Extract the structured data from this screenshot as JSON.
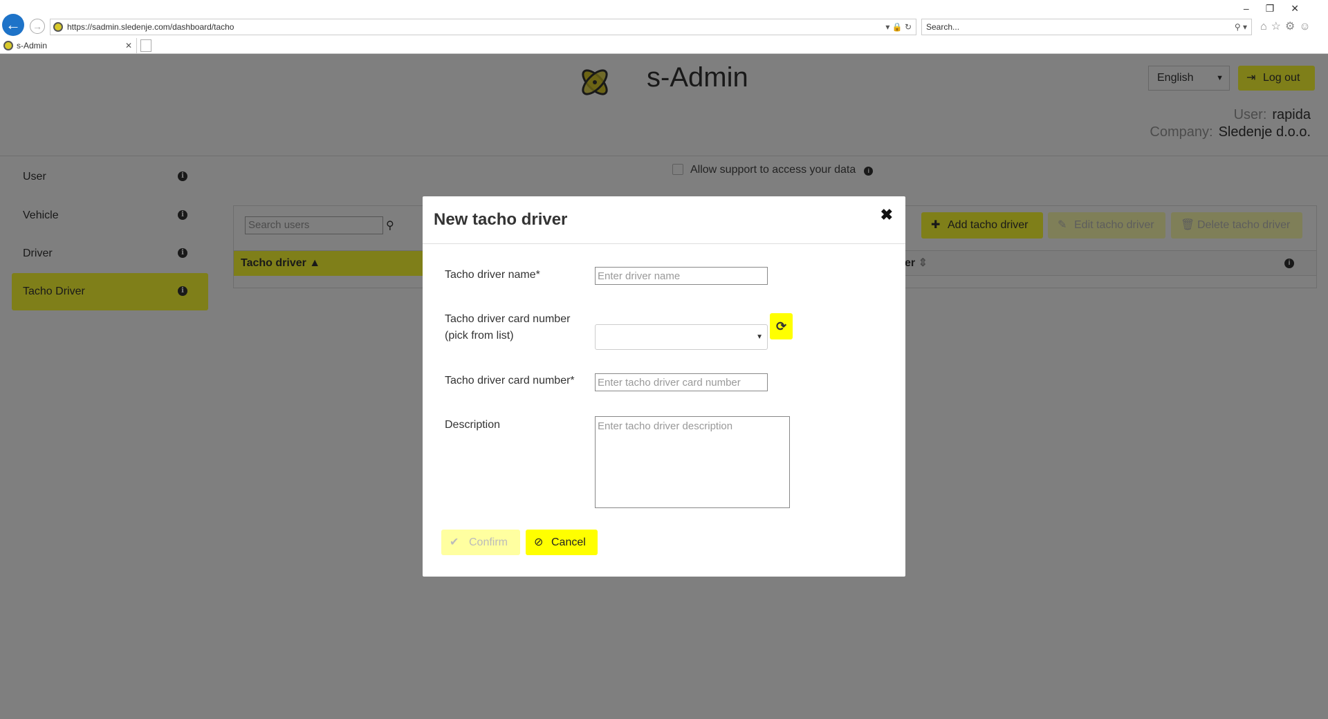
{
  "browser": {
    "url": "https://sadmin.sledenje.com/dashboard/tacho",
    "search_placeholder": "Search...",
    "tab_title": "s-Admin",
    "window_controls": "–❐✕"
  },
  "header": {
    "title": "s-Admin",
    "language": "English",
    "logout": "Log out",
    "user_label": "User:",
    "user": "rapida",
    "company_label": "Company:",
    "company": "Sledenje d.o.o."
  },
  "sidebar": {
    "items": [
      {
        "label": "User"
      },
      {
        "label": "Vehicle"
      },
      {
        "label": "Driver"
      },
      {
        "label": "Tacho Driver",
        "active": true
      }
    ]
  },
  "support": {
    "label": "Allow support to access your data",
    "checked": false
  },
  "panel": {
    "search_placeholder": "Search users",
    "add": "Add tacho driver",
    "edit": "Edit tacho driver",
    "delete": "Delete tacho driver",
    "col1": "Tacho driver",
    "col2": "er"
  },
  "modal": {
    "title": "New tacho driver",
    "name_label": "Tacho driver name*",
    "name_placeholder": "Enter driver name",
    "pick_label_1": "Tacho driver card number",
    "pick_label_2": "(pick from list)",
    "card_label": "Tacho driver card number*",
    "card_placeholder": "Enter tacho driver card number",
    "desc_label": "Description",
    "desc_placeholder": "Enter tacho driver description",
    "confirm": "Confirm",
    "cancel": "Cancel"
  },
  "colors": {
    "accent": "#ffff33",
    "cancel": "#ffff00",
    "disabled": "#ffffa0"
  }
}
